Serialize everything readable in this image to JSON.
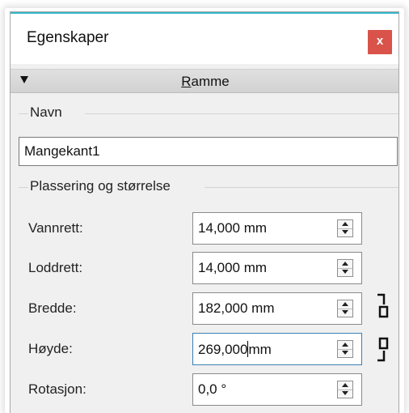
{
  "window": {
    "title": "Egenskaper",
    "close_label": "x",
    "accent_color": "#34b8c9",
    "close_color": "#d9534a"
  },
  "section": {
    "title_accel": "R",
    "title_rest": "amme",
    "collapse_icon": "triangle-down-icon"
  },
  "name_group": {
    "label": "Navn",
    "value": "Mangekant1"
  },
  "position_group": {
    "label": "Plassering og størrelse",
    "fields": [
      {
        "label": "Vannrett:",
        "value": "14,000 mm"
      },
      {
        "label": "Loddrett:",
        "value": "14,000 mm"
      },
      {
        "label": "Bredde:",
        "value": "182,000 mm"
      },
      {
        "label": "Høyde:",
        "value_before_caret": "269,000",
        "value_after_caret": "mm"
      },
      {
        "label": "Rotasjon:",
        "value": "0,0 °"
      }
    ],
    "link_icon": "keep-ratio-link-icon"
  }
}
